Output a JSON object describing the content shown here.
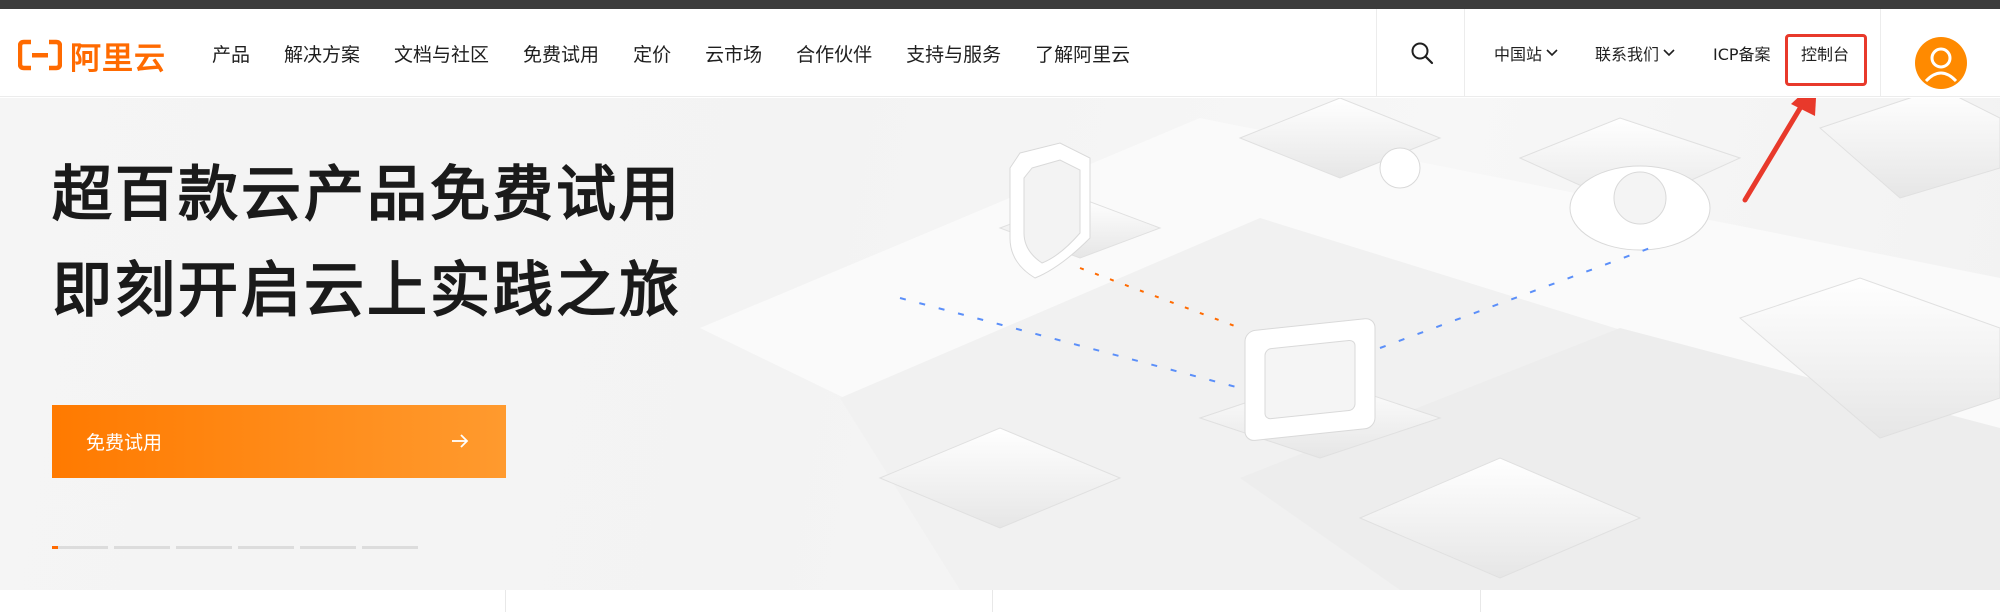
{
  "brand": {
    "name": "阿里云",
    "color": "#ff6a00"
  },
  "nav": {
    "items": [
      "产品",
      "解决方案",
      "文档与社区",
      "免费试用",
      "定价",
      "云市场",
      "合作伙伴",
      "支持与服务",
      "了解阿里云"
    ]
  },
  "right_nav": {
    "site_label": "中国站",
    "contact_label": "联系我们",
    "icp_label": "ICP备案",
    "console_label": "控制台"
  },
  "hero": {
    "title_line1": "超百款云产品免费试用",
    "title_line2": "即刻开启云上实践之旅",
    "cta_label": "免费试用"
  },
  "carousel": {
    "slide_count": 6,
    "active_index": 0
  },
  "colors": {
    "accent": "#ff6a00",
    "annotation": "#e8392b"
  },
  "icons": [
    "search-icon",
    "chevron-down-icon",
    "arrow-right-icon",
    "avatar-icon",
    "annotation-arrow-icon"
  ]
}
